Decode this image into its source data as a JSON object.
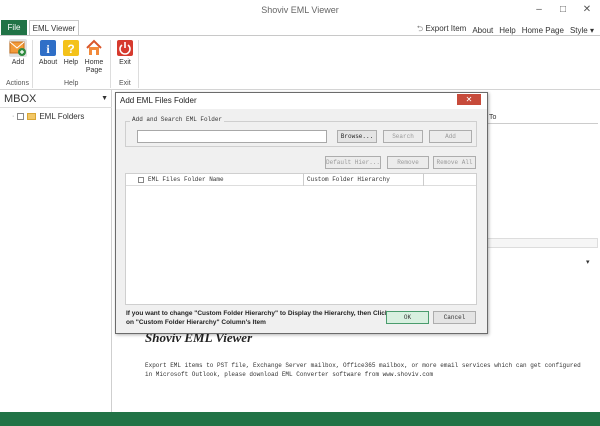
{
  "app": {
    "title": "Shoviv EML Viewer"
  },
  "window_controls": {
    "minimize": "–",
    "maximize": "□",
    "close": "✕"
  },
  "tabs": {
    "file": "File",
    "eml_viewer": "EML Viewer"
  },
  "top_links": {
    "export": "Export Item",
    "about": "About",
    "help": "Help",
    "home": "Home Page",
    "style": "Style"
  },
  "ribbon": {
    "add": "Add",
    "about": "About",
    "help": "Help",
    "home_page": "Home\nPage",
    "exit": "Exit",
    "groups": {
      "actions": "Actions",
      "help": "Help",
      "exit": "Exit"
    }
  },
  "left_pane": {
    "header": "MBOX",
    "tree_item": "EML Folders"
  },
  "bg_panel": {
    "column_to": "To",
    "product_title": "Shoviv EML Viewer",
    "description": "Export EML items to PST file, Exchange Server mailbox, Office365 mailbox, or more email services which can get configured in Microsoft Outlook, please download EML Converter software from www.shoviv.com"
  },
  "dialog": {
    "title": "Add EML Files Folder",
    "group_label": "Add and Search EML Folder",
    "browse": "Browse...",
    "search": "Search",
    "add": "Add",
    "default_hier": "Default Hier...",
    "remove": "Remove",
    "remove_all": "Remove All",
    "col_folder": "EML Files Folder Name",
    "col_hierarchy": "Custom Folder Hierarchy",
    "note": "If you want to change \"Custom Folder Hierarchy\" to Display the Hierarchy, then Click on \"Custom Folder Hierarchy\" Column's Item",
    "ok": "OK",
    "cancel": "Cancel"
  },
  "colors": {
    "brand_green": "#217346",
    "close_red": "#c74b3b"
  }
}
